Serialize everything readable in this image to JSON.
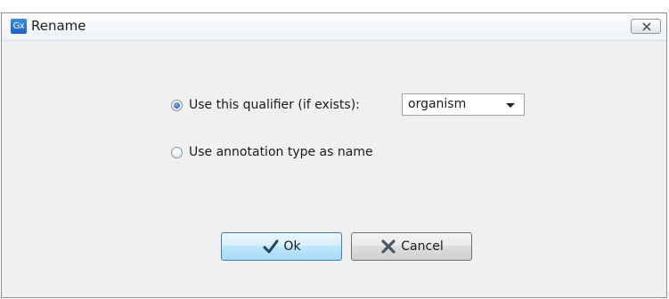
{
  "window": {
    "title": "Rename",
    "app_icon_text": "Gx"
  },
  "options": {
    "qualifier_label": "Use this qualifier (if exists):",
    "annotation_type_label": "Use annotation type as name",
    "selected": "qualifier"
  },
  "qualifier_select": {
    "value": "organism"
  },
  "buttons": {
    "ok_label": "Ok",
    "cancel_label": "Cancel"
  },
  "icons": {
    "app": "gx-app-icon",
    "close": "close-icon",
    "ok": "checkmark-icon",
    "cancel": "x-icon"
  },
  "colors": {
    "ok_button_border": "#3c7fb1",
    "radio_selected": "#1f5aa8"
  }
}
